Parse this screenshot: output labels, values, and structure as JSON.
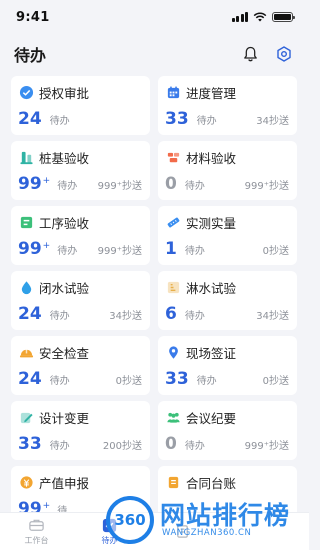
{
  "status_bar": {
    "time": "9:41"
  },
  "header": {
    "title": "待办"
  },
  "cards": [
    {
      "key": "auth",
      "title": "授权审批",
      "icon": "check-shield-icon",
      "color": "#3a8ef0",
      "count": "24",
      "sup": "",
      "pending": "待办",
      "cc": ""
    },
    {
      "key": "progress",
      "title": "进度管理",
      "icon": "calendar-icon",
      "color": "#3a7bea",
      "count": "33",
      "sup": "",
      "pending": "待办",
      "cc": "34抄送"
    },
    {
      "key": "pile",
      "title": "桩基验收",
      "icon": "pile-icon",
      "color": "#2fb3a4",
      "count": "99",
      "sup": "+",
      "pending": "待办",
      "cc": "999⁺抄送"
    },
    {
      "key": "material",
      "title": "材料验收",
      "icon": "bricks-icon",
      "color": "#f26b4a",
      "count": "0",
      "sup": "",
      "pending": "待办",
      "cc": "999⁺抄送"
    },
    {
      "key": "process",
      "title": "工序验收",
      "icon": "process-icon",
      "color": "#3cc07a",
      "count": "99",
      "sup": "+",
      "pending": "待办",
      "cc": "999⁺抄送"
    },
    {
      "key": "measure",
      "title": "实测实量",
      "icon": "ruler-icon",
      "color": "#3a8ef0",
      "count": "1",
      "sup": "",
      "pending": "待办",
      "cc": "0抄送"
    },
    {
      "key": "closed",
      "title": "闭水试验",
      "icon": "water-drop-icon",
      "color": "#2fa0e8",
      "count": "24",
      "sup": "",
      "pending": "待办",
      "cc": "34抄送"
    },
    {
      "key": "shower",
      "title": "淋水试验",
      "icon": "shower-icon",
      "color": "#e8b04a",
      "count": "6",
      "sup": "",
      "pending": "待办",
      "cc": "34抄送"
    },
    {
      "key": "safety",
      "title": "安全检查",
      "icon": "helmet-icon",
      "color": "#f2a531",
      "count": "24",
      "sup": "",
      "pending": "待办",
      "cc": "0抄送"
    },
    {
      "key": "visa",
      "title": "现场签证",
      "icon": "location-pin-icon",
      "color": "#3a7bea",
      "count": "33",
      "sup": "",
      "pending": "待办",
      "cc": "0抄送"
    },
    {
      "key": "design",
      "title": "设计变更",
      "icon": "edit-icon",
      "color": "#2fb3a4",
      "count": "33",
      "sup": "",
      "pending": "待办",
      "cc": "200抄送"
    },
    {
      "key": "meeting",
      "title": "会议纪要",
      "icon": "people-icon",
      "color": "#3cc07a",
      "count": "0",
      "sup": "",
      "pending": "待办",
      "cc": "999⁺抄送"
    },
    {
      "key": "output",
      "title": "产值申报",
      "icon": "coin-icon",
      "color": "#f2a531",
      "count": "99",
      "sup": "+",
      "pending": "待",
      "cc": ""
    },
    {
      "key": "contract",
      "title": "合同台账",
      "icon": "ledger-icon",
      "color": "#f2a531",
      "count": "",
      "sup": "",
      "pending": "",
      "cc": ""
    }
  ],
  "tabbar": {
    "items": [
      {
        "label": "工作台",
        "icon": "briefcase-icon",
        "active": false
      },
      {
        "label": "待办",
        "icon": "todo-icon",
        "active": true
      },
      {
        "label": "",
        "icon": "building-icon",
        "active": false
      }
    ]
  },
  "watermark": {
    "logo": "360",
    "text": "网站排行榜",
    "sub": "WANGZHAN360.CN"
  },
  "colors": {
    "accent": "#2e62d9",
    "muted": "#8d9199",
    "background": "#f3f4f8"
  }
}
